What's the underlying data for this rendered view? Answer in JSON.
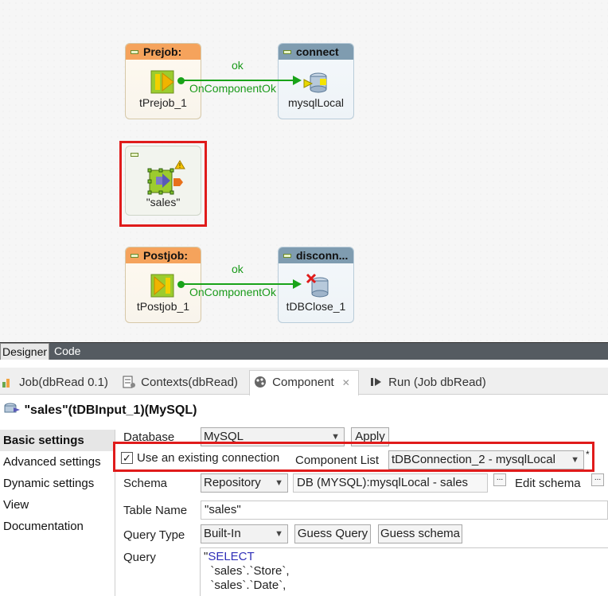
{
  "canvas": {
    "prejob": {
      "header": "Prejob:",
      "label": "tPrejob_1"
    },
    "connect": {
      "header": "connect",
      "label": "mysqlLocal"
    },
    "edge1": {
      "ok": "ok",
      "trigger": "OnComponentOk"
    },
    "sales": {
      "label": "\"sales\""
    },
    "postjob": {
      "header": "Postjob:",
      "label": "tPostjob_1"
    },
    "disconnect": {
      "header": "disconn...",
      "label": "tDBClose_1"
    },
    "edge2": {
      "ok": "ok",
      "trigger": "OnComponentOk"
    }
  },
  "view_tabs": [
    "Designer",
    "Code"
  ],
  "panel_tabs": [
    {
      "label": "Job(dbRead 0.1)",
      "icon": "job-icon"
    },
    {
      "label": "Contexts(dbRead)",
      "icon": "contexts-icon"
    },
    {
      "label": "Component",
      "icon": "component-icon"
    },
    {
      "label": "Run (Job dbRead)",
      "icon": "run-icon"
    }
  ],
  "component_title": "\"sales\"(tDBInput_1)(MySQL)",
  "left_nav": [
    "Basic settings",
    "Advanced settings",
    "Dynamic settings",
    "View",
    "Documentation"
  ],
  "form": {
    "database_label": "Database",
    "database_value": "MySQL",
    "apply_label": "Apply",
    "use_existing_label": "Use an existing connection",
    "use_existing_checked": true,
    "component_list_label": "Component List",
    "component_list_value": "tDBConnection_2 - mysqlLocal",
    "required_mark": "*",
    "schema_label": "Schema",
    "schema_type": "Repository",
    "schema_value": "DB (MYSQL):mysqlLocal - sales",
    "edit_schema_label": "Edit schema",
    "table_name_label": "Table Name",
    "table_name_value": "\"sales\"",
    "query_type_label": "Query Type",
    "query_type_value": "Built-In",
    "guess_query_label": "Guess Query",
    "guess_schema_label": "Guess schema",
    "query_label": "Query",
    "query_lines": [
      "\"SELECT",
      "  `sales`.`Store`,",
      "  `sales`.`Date`,"
    ]
  },
  "colors": {
    "highlight_red": "#e01b1b",
    "link_green": "#19a319",
    "prejob_orange": "#f5a35c",
    "db_header_slate": "#7f9cb0"
  }
}
